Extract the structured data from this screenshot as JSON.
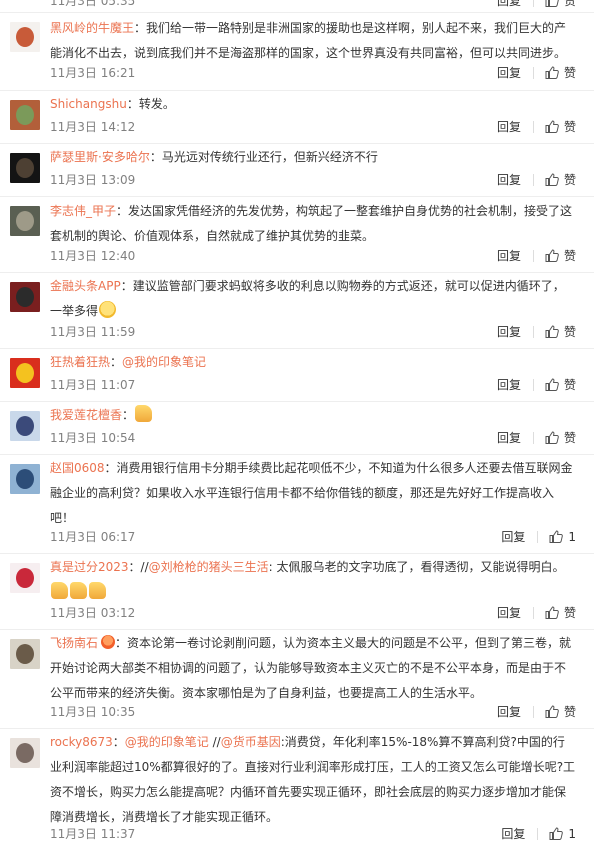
{
  "feed": {
    "reply_label": "回复",
    "like_label": "赞",
    "comments": [
      {
        "user": "黑风岭的牛魔王",
        "badge": false,
        "avatar_colors": [
          "#f4f1ee",
          "#c85b39"
        ],
        "lines": [
          "：我们给一带一路特别是非洲国家的援助也是这样啊，别人起不来，我们巨大的产",
          "能消化不出去，说到底我们并不是海盗那样的国家，这个世界真没有共同富裕，但可以共同进步。"
        ],
        "time": "11月3日 16:21",
        "likes": ""
      },
      {
        "user": "Shichangshu",
        "badge": false,
        "avatar_colors": [
          "#b25f3a",
          "#7b9a5a"
        ],
        "lines": [
          "：转发。"
        ],
        "time": "11月3日 14:12",
        "likes": ""
      },
      {
        "user": "萨瑟里斯·安多哈尔",
        "badge": false,
        "avatar_colors": [
          "#141414",
          "#4d4033"
        ],
        "lines": [
          "：马光远对传统行业还行，但新兴经济不行"
        ],
        "time": "11月3日 13:09",
        "likes": ""
      },
      {
        "user": "李志伟_甲子",
        "badge": false,
        "avatar_colors": [
          "#5a5f52",
          "#9e9a88"
        ],
        "lines": [
          "：发达国家凭借经济的先发优势，构筑起了一整套维护自身优势的社会机制，接受了",
          "这套机制的舆论、价值观体系，自然就成了维护其优势的韭菜。"
        ],
        "time": "11月3日 12:40",
        "likes": ""
      },
      {
        "user": "金融头条APP",
        "badge": false,
        "avatar_colors": [
          "#7a1f1f",
          "#2b2b2b"
        ],
        "lines": [
          "：建议监管部门要求蚂蚁将多收的利息以购物券的方式返还，就可以促进内循环了，",
          "一举多得"
        ],
        "emoji_after_last_line": "smile",
        "time": "11月3日 11:59",
        "likes": ""
      },
      {
        "user": "狂热着狂热",
        "badge": false,
        "avatar_colors": [
          "#d92e1d",
          "#f4c21f"
        ],
        "lines": [
          "："
        ],
        "mention": "@我的印象笔记",
        "time": "11月3日 11:07",
        "likes": ""
      },
      {
        "user": "我爱莲花檀香",
        "badge": false,
        "avatar_colors": [
          "#c9d8ea",
          "#3b4a7a"
        ],
        "lines": [
          "："
        ],
        "emoji_after_last_line": "thumb",
        "time": "11月3日 10:54",
        "likes": ""
      },
      {
        "user": "赵国0608",
        "badge": false,
        "avatar_colors": [
          "#8fb2d3",
          "#2c4d78"
        ],
        "lines": [
          "：消费用银行信用卡分期手续费比起花呗低不少，不知道为什么很多人还要去借互联网金",
          "融企业的高利贷？如果收入水平连银行信用卡都不给你借钱的额度，那还是先好好工作提高收入",
          "吧！"
        ],
        "time": "11月3日 06:17",
        "likes": "1"
      },
      {
        "user": "真是过分2023",
        "badge": false,
        "avatar_colors": [
          "#f6eef0",
          "#c9283a"
        ],
        "lines": [
          "：//",
          "@刘枪枪的猪头三生活",
          ": 太佩服乌老的文字功底了，看得透彻，又能说得明白。"
        ],
        "second_row_thumbs": 3,
        "time": "11月3日 03:12",
        "likes": ""
      },
      {
        "user": "飞扬南石",
        "badge": true,
        "avatar_colors": [
          "#d8d3c7",
          "#6a5b49"
        ],
        "lines": [
          "：资本论第一卷讨论剥削问题，认为资本主义最大的问题是不公平，但到了第三卷，",
          "就开始讨论两大部类不相协调的问题了，认为能够导致资本主义灭亡的不是不公平本身，而是由于",
          "不公平而带来的经济失衡。资本家哪怕是为了自身利益，也要提高工人的生活水平。"
        ],
        "time": "11月3日 10:35",
        "likes": ""
      },
      {
        "user": "rocky8673",
        "badge": false,
        "avatar_colors": [
          "#e9e2dd",
          "#7a6a63"
        ],
        "lines": [
          "：",
          "@我的印象笔记",
          " //",
          "@货币基因",
          ":消费贷，年化利率15%-18%算不算高利贷?中国的行业",
          "利润率能超过10%都算很好的了。直接对行业利润率形成打压，工人的工资又怎么可能增长呢?工",
          "资不增长，购买力怎么能提高呢？内循环首先要实现正循环，即社会底层的购买力逐步增加才能保",
          "障消费增长，消费增长了才能实现正循环。"
        ],
        "time": "11月3日 11:37",
        "likes": "1"
      }
    ],
    "top_partial": {
      "time": "11月3日 05:35",
      "reply": "回复",
      "like": "赞"
    }
  }
}
